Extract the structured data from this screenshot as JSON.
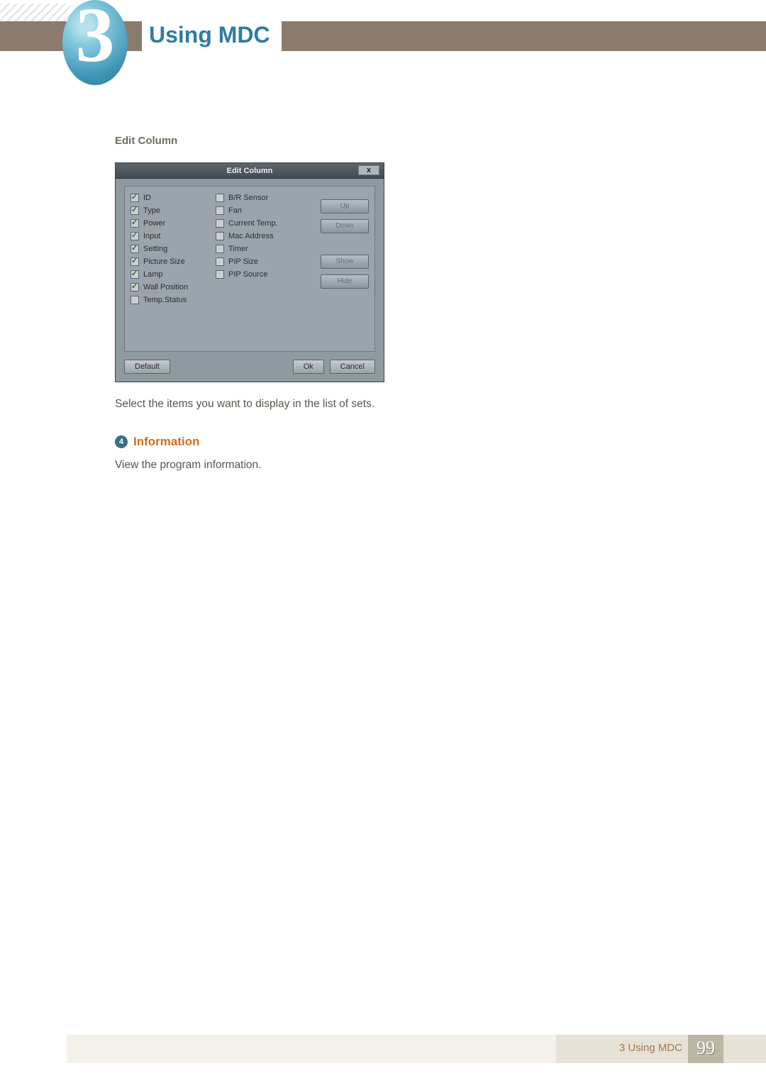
{
  "chapter": {
    "number": "3",
    "title": "Using MDC"
  },
  "section": {
    "heading": "Edit Column"
  },
  "dialog": {
    "title": "Edit Column",
    "close": "x",
    "col1": [
      {
        "label": "ID",
        "checked": true
      },
      {
        "label": "Type",
        "checked": true
      },
      {
        "label": "Power",
        "checked": true
      },
      {
        "label": "Input",
        "checked": true
      },
      {
        "label": "Setting",
        "checked": true
      },
      {
        "label": "Picture Size",
        "checked": true
      },
      {
        "label": "Lamp",
        "checked": true
      },
      {
        "label": "Wall Position",
        "checked": true
      },
      {
        "label": "Temp.Status",
        "checked": false
      }
    ],
    "col2": [
      {
        "label": "B/R Sensor",
        "checked": false
      },
      {
        "label": "Fan",
        "checked": false
      },
      {
        "label": "Current Temp.",
        "checked": false
      },
      {
        "label": "Mac Address",
        "checked": false
      },
      {
        "label": "Timer",
        "checked": false
      },
      {
        "label": "PIP Size",
        "checked": false
      },
      {
        "label": "PIP Source",
        "checked": false
      }
    ],
    "side_buttons": {
      "up": "Up",
      "down": "Down",
      "show": "Show",
      "hide": "Hide"
    },
    "footer": {
      "default": "Default",
      "ok": "Ok",
      "cancel": "Cancel"
    }
  },
  "body_text": "Select the items you want to display in the list of sets.",
  "step": {
    "num": "4",
    "title": "Information",
    "desc": "View the program information."
  },
  "footer": {
    "text": "3 Using MDC",
    "page": "99"
  }
}
